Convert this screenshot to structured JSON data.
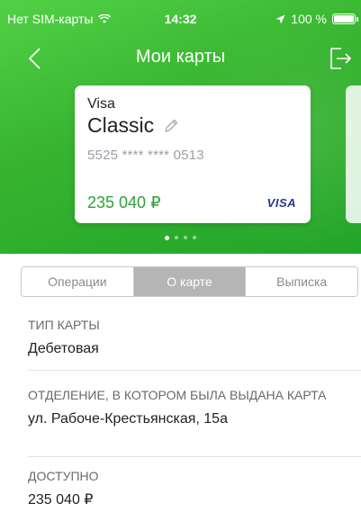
{
  "status_bar": {
    "carrier": "Нет SIM-карты",
    "wifi_icon": "wifi-icon",
    "time": "14:32",
    "location_icon": "location-arrow-icon",
    "battery_percent": "100 %",
    "battery_level": 1.0
  },
  "nav": {
    "title": "Мои карты",
    "back_icon": "chevron-left-icon",
    "logout_icon": "logout-icon"
  },
  "card": {
    "brand": "Visa",
    "name": "Classic",
    "edit_icon": "pencil-icon",
    "number": "5525 **** **** 0513",
    "balance": "235 040 ₽",
    "logo_text": "VISA"
  },
  "pager": {
    "total": 4,
    "active_index": 0
  },
  "tabs": [
    {
      "label": "Операции",
      "active": false
    },
    {
      "label": "О карте",
      "active": true
    },
    {
      "label": "Выписка",
      "active": false
    }
  ],
  "details": [
    {
      "label": "ТИП КАРТЫ",
      "value": "Дебетовая"
    },
    {
      "label": "ОТДЕЛЕНИЕ, В КОТОРОМ БЫЛА ВЫДАНА КАРТА",
      "value": "ул. Рабоче-Крестьянская, 15а"
    },
    {
      "label": "ДОСТУПНО",
      "value": "235 040 ₽"
    }
  ],
  "colors": {
    "header_green": "#37b32f",
    "balance_green": "#2ca234",
    "active_tab": "#b5b5b5"
  }
}
